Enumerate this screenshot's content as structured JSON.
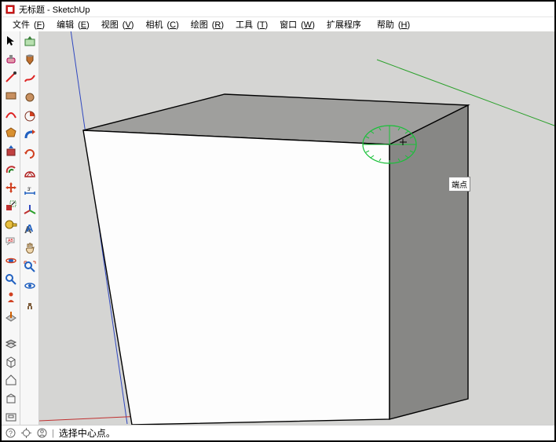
{
  "window": {
    "title": "无标题 - SketchUp"
  },
  "menu": {
    "file": {
      "label": "文件",
      "key": "F"
    },
    "edit": {
      "label": "编辑",
      "key": "E"
    },
    "view": {
      "label": "视图",
      "key": "V"
    },
    "camera": {
      "label": "相机",
      "key": "C"
    },
    "draw": {
      "label": "绘图",
      "key": "R"
    },
    "tools": {
      "label": "工具",
      "key": "T"
    },
    "window": {
      "label": "窗口",
      "key": "W"
    },
    "ext": {
      "label": "扩展程序"
    },
    "help": {
      "label": "帮助",
      "key": "H"
    }
  },
  "tooltip": {
    "endpoint": "端点"
  },
  "status": {
    "text": "选择中心点。"
  },
  "colors": {
    "axis_x": "#c03030",
    "axis_y": "#2aa02a",
    "axis_z": "#3048c0",
    "protractor": "#18c038"
  }
}
